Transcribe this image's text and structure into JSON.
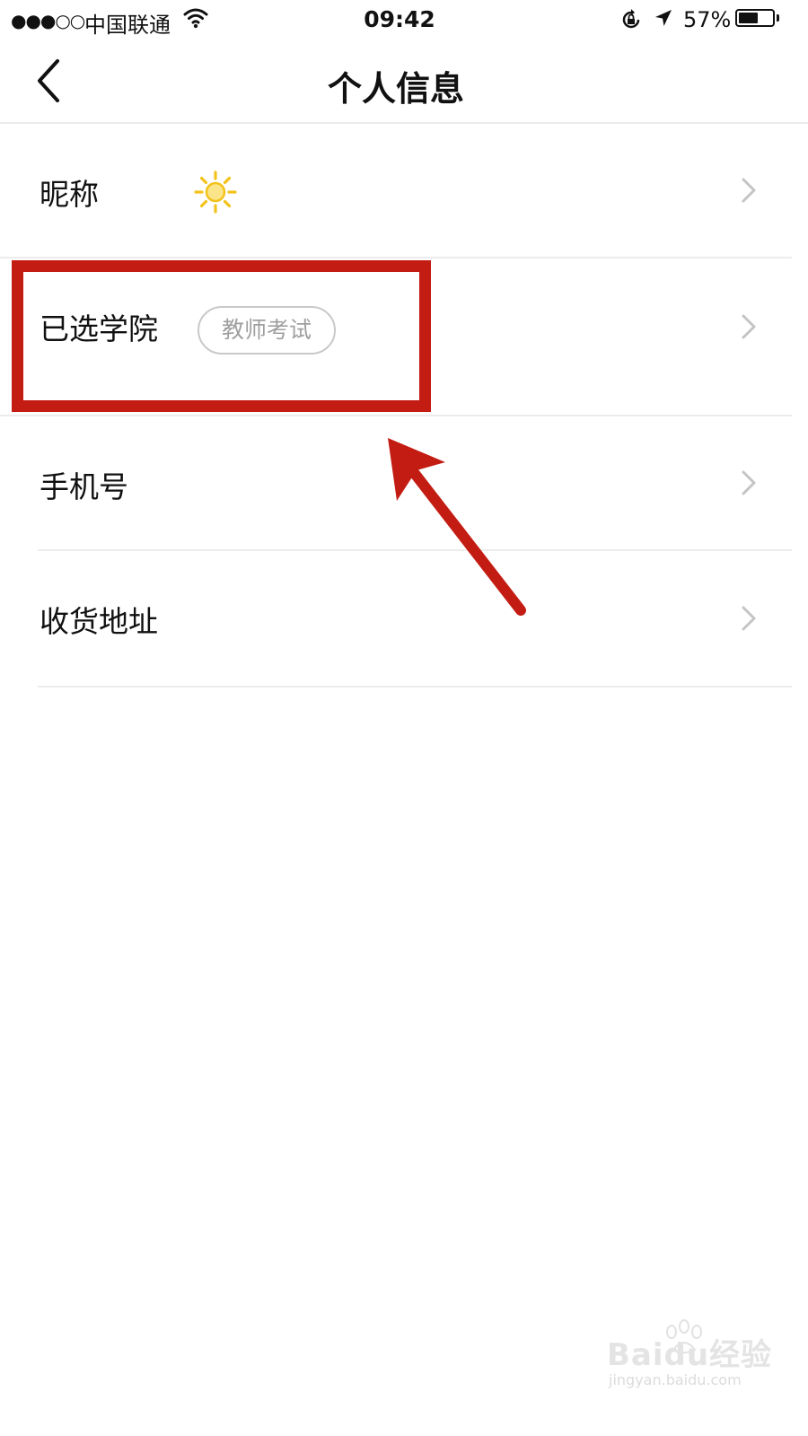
{
  "status_bar": {
    "signal": "●●●○○",
    "carrier": "中国联通",
    "time": "09:42",
    "battery_percent": "57%",
    "battery_level": 0.57,
    "icons": [
      "wifi-icon",
      "rotation-lock-icon",
      "location-arrow-icon",
      "battery-icon"
    ]
  },
  "nav": {
    "title": "个人信息",
    "back_icon": "chevron-left-icon"
  },
  "items": [
    {
      "label": "昵称",
      "value_icon": "sun-emoji-icon"
    },
    {
      "label": "已选学院",
      "badge": "教师考试"
    },
    {
      "label": "手机号"
    },
    {
      "label": "收货地址"
    }
  ],
  "annotation": {
    "color": "#c31c13",
    "highlighted_item": "已选学院"
  },
  "watermark": {
    "text": "Baidu经验",
    "url": "jingyan.baidu.com"
  }
}
